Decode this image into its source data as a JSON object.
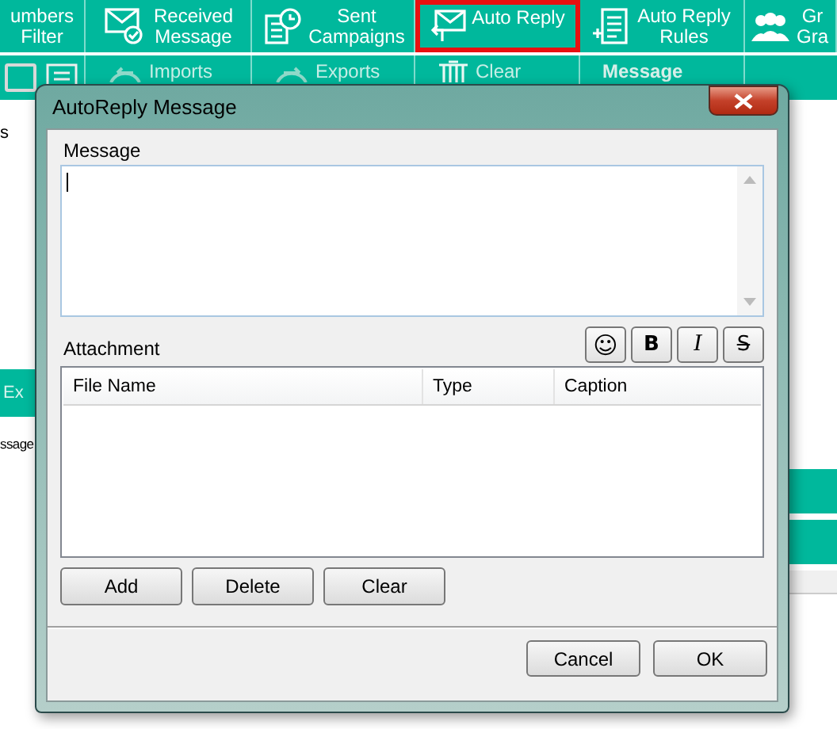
{
  "ribbon": {
    "items": [
      {
        "lines": [
          "umbers",
          "Filter"
        ],
        "selected": false
      },
      {
        "lines": [
          "Received",
          "Message"
        ],
        "selected": false
      },
      {
        "lines": [
          "Sent",
          "Campaigns"
        ],
        "selected": false
      },
      {
        "lines": [
          "Auto Reply"
        ],
        "selected": true
      },
      {
        "lines": [
          "Auto Reply",
          "Rules"
        ],
        "selected": false
      },
      {
        "lines": [
          "Gr",
          "Gra"
        ],
        "selected": false
      }
    ],
    "tools": [
      "Imports",
      "Exports",
      "Clear",
      "Message"
    ]
  },
  "background": {
    "left_texts": [
      "s",
      "Ex",
      "ssage"
    ]
  },
  "dialog": {
    "title": "AutoReply Message",
    "message_label": "Message",
    "format_buttons": [
      {
        "kind": "emoji",
        "label": "☺"
      },
      {
        "kind": "bold",
        "label": "B"
      },
      {
        "kind": "italic",
        "label": "I"
      },
      {
        "kind": "strike",
        "label": "S"
      }
    ],
    "attachment_label": "Attachment",
    "table": {
      "columns": [
        "File Name",
        "Type",
        "Caption"
      ]
    },
    "list_buttons": [
      "Add",
      "Delete",
      "Clear"
    ],
    "footer_buttons": [
      "Cancel",
      "OK"
    ]
  }
}
